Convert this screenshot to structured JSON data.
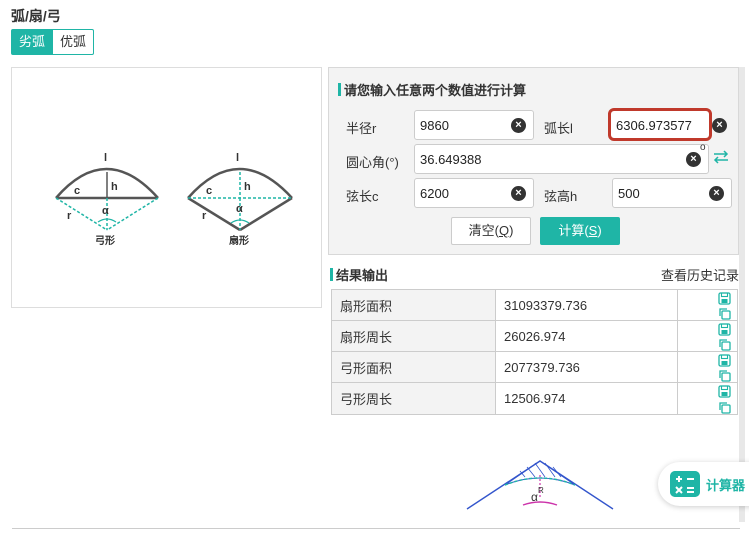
{
  "page": {
    "title": "弧/扇/弓"
  },
  "tabs": [
    {
      "label": "劣弧"
    },
    {
      "label": "优弧"
    }
  ],
  "diagram": {
    "segment": {
      "caption": "弓形",
      "l": "l",
      "h": "h",
      "c": "c",
      "r": "r",
      "alpha": "α"
    },
    "sector": {
      "caption": "扇形",
      "l": "l",
      "h": "h",
      "c": "c",
      "r": "r",
      "alpha": "α"
    }
  },
  "calc": {
    "title": "请您输入任意两个数值进行计算",
    "radius": {
      "label": "半径r",
      "value": "9860"
    },
    "arc_length": {
      "label": "弧长l",
      "value": "6306.973577"
    },
    "angle": {
      "label": "圆心角(°)",
      "value": "36.649388",
      "unit": "o"
    },
    "chord": {
      "label": "弦长c",
      "value": "6200"
    },
    "height": {
      "label": "弦高h",
      "value": "500"
    },
    "clear_label": "清空(",
    "clear_key": "Q",
    "clear_end": ")",
    "calc_label": "计算(",
    "calc_key": "S",
    "calc_end": ")"
  },
  "results": {
    "title": "结果输出",
    "history_link": "查看历史记录",
    "rows": [
      {
        "name": "扇形面积",
        "value": "31093379.736"
      },
      {
        "name": "扇形周长",
        "value": "26026.974"
      },
      {
        "name": "弓形面积",
        "value": "2077379.736"
      },
      {
        "name": "弓形周长",
        "value": "12506.974"
      }
    ]
  },
  "bottom_figure": {
    "alpha": "α",
    "r": "R"
  },
  "float_button": {
    "label": "计算器"
  },
  "colors": {
    "accent": "#1fb5a6",
    "highlight": "#c0392b"
  }
}
